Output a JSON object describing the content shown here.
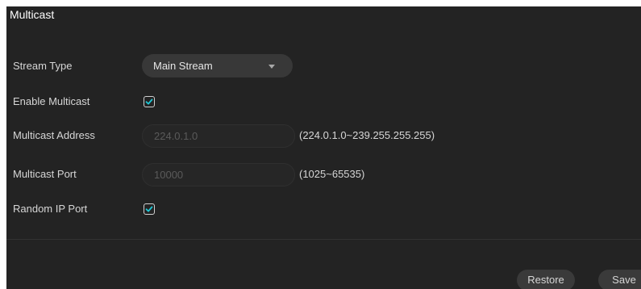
{
  "panel": {
    "title": "Multicast"
  },
  "form": {
    "stream_type": {
      "label": "Stream Type",
      "value": "Main Stream"
    },
    "enable_multicast": {
      "label": "Enable Multicast",
      "checked": true
    },
    "multicast_address": {
      "label": "Multicast Address",
      "value": "224.0.1.0",
      "hint": "(224.0.1.0~239.255.255.255)"
    },
    "multicast_port": {
      "label": "Multicast Port",
      "value": "10000",
      "hint": "(1025~65535)"
    },
    "random_ip_port": {
      "label": "Random IP Port",
      "checked": true
    }
  },
  "actions": {
    "restore_label": "Restore",
    "save_label": "Save"
  },
  "colors": {
    "accent": "#1ec8d6",
    "panel_bg": "#232323",
    "control_bg": "#383838"
  }
}
